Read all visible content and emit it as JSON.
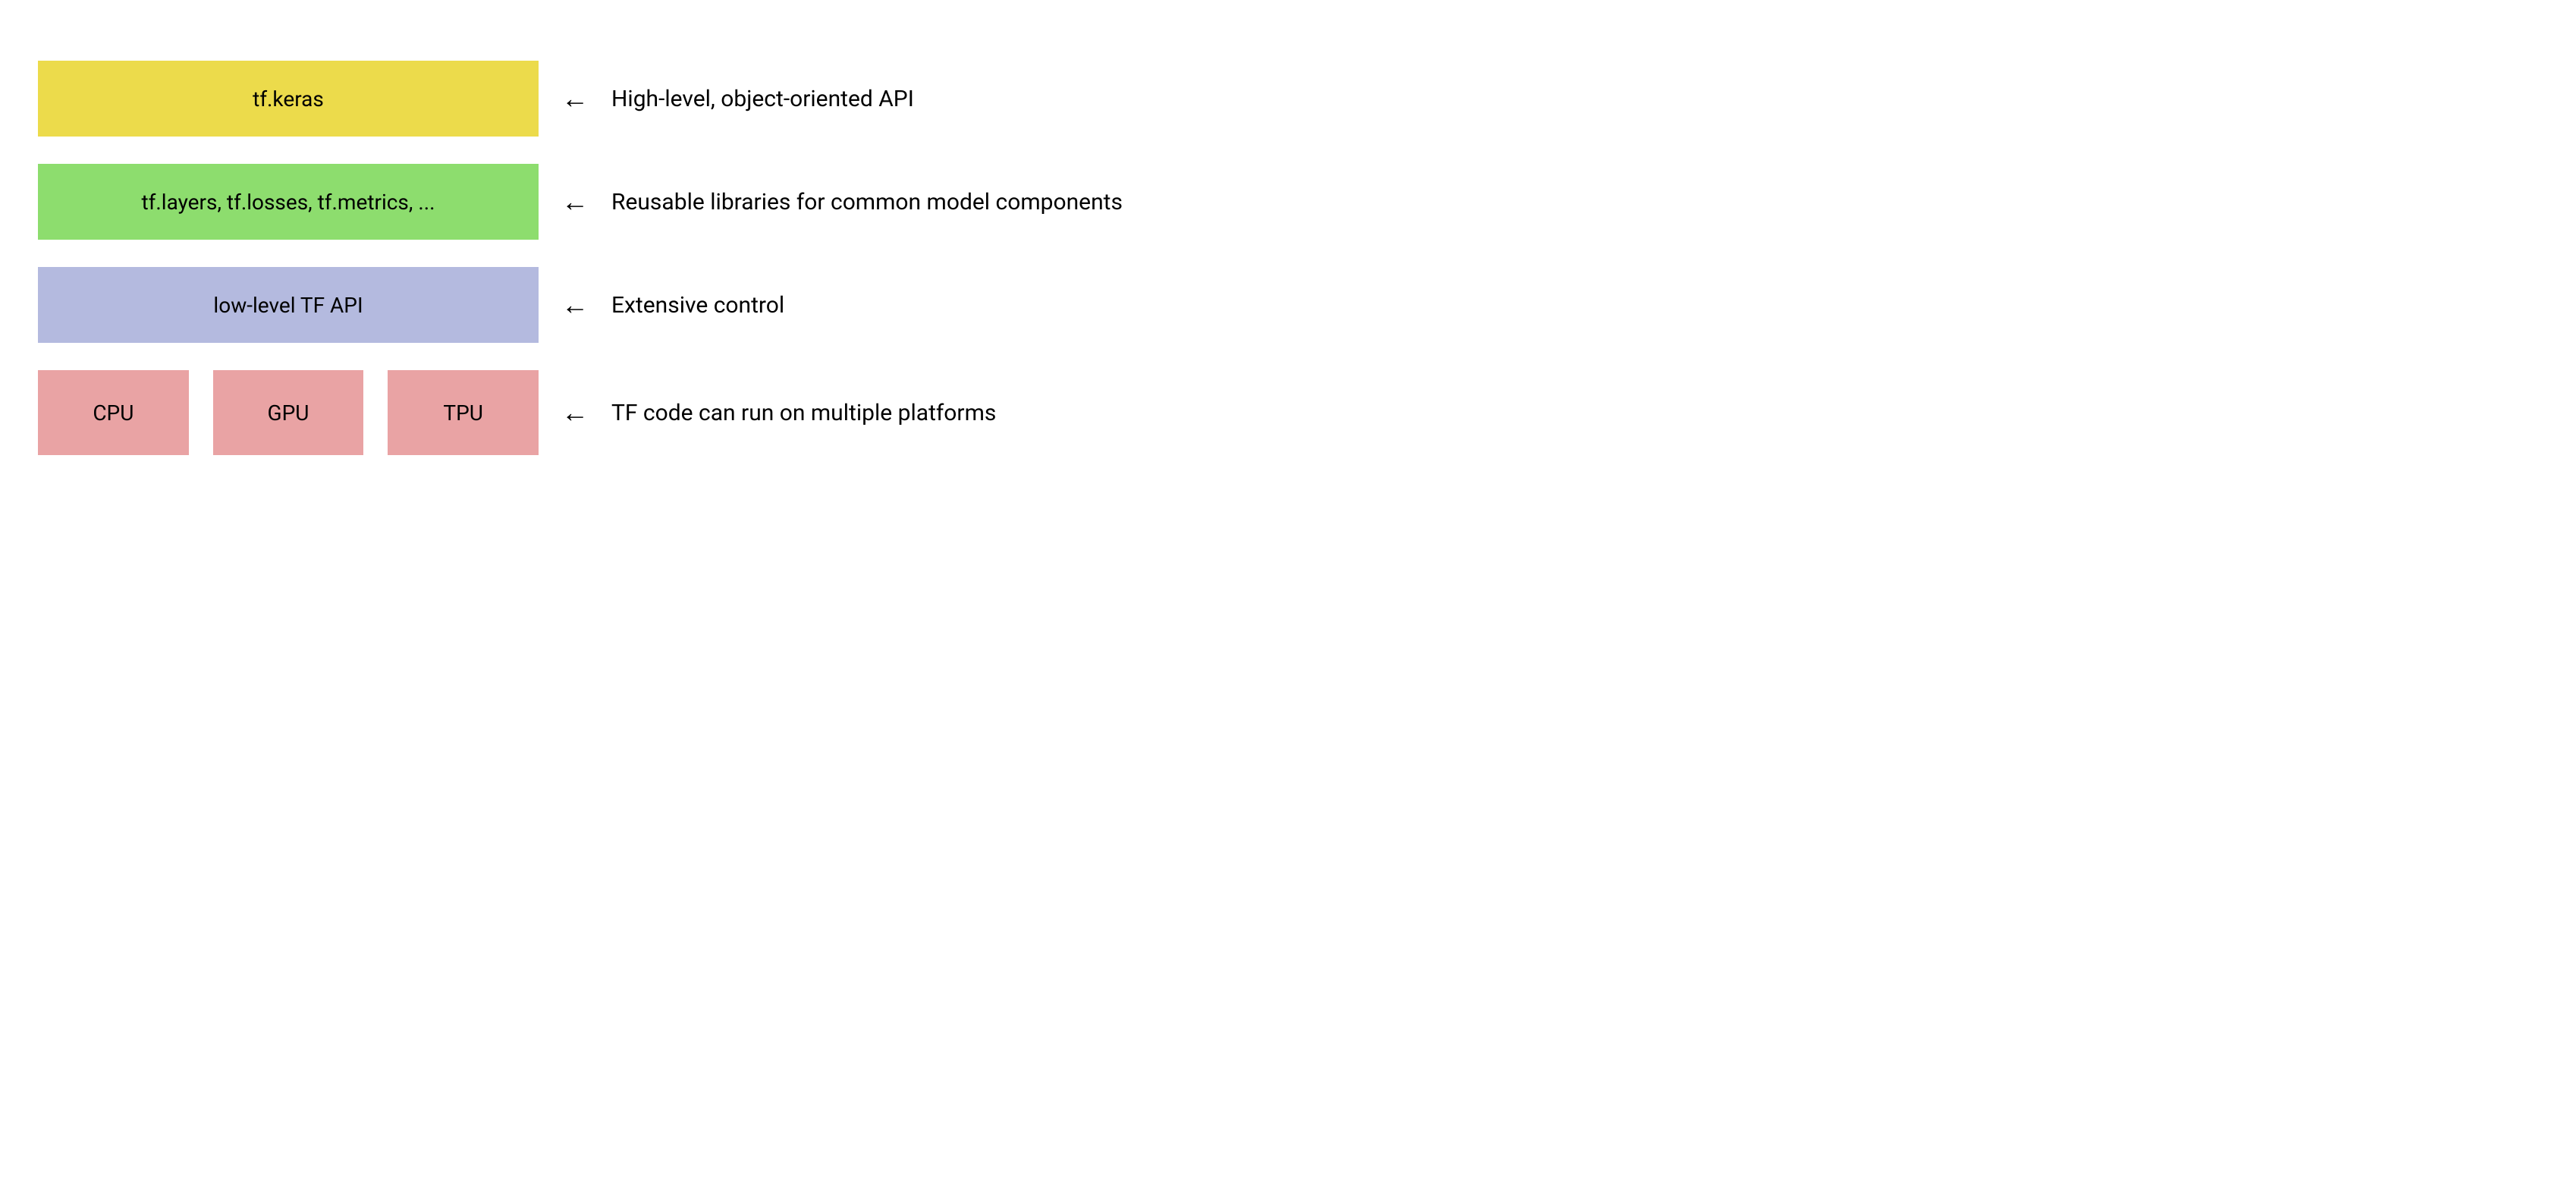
{
  "layers": [
    {
      "block_label": "tf.keras",
      "color_class": "yellow",
      "description": "High-level, object-oriented API"
    },
    {
      "block_label": "tf.layers, tf.losses, tf.metrics, ...",
      "color_class": "green",
      "description": "Reusable libraries for common model components"
    },
    {
      "block_label": "low-level TF API",
      "color_class": "purple",
      "description": "Extensive control"
    }
  ],
  "hardware": {
    "items": [
      "CPU",
      "GPU",
      "TPU"
    ],
    "color_class": "pink",
    "description": "TF code can run on multiple platforms"
  },
  "arrow_glyph": "←"
}
